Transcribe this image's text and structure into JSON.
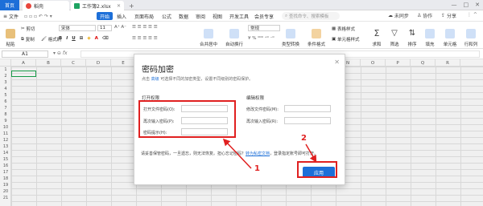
{
  "tabs": {
    "home": "首页",
    "doc": "稻壳",
    "file": "工作簿2.xlsx",
    "plus": "+"
  },
  "menu": {
    "file": "文件",
    "start": "开始",
    "insert": "插入",
    "page_layout": "页面布局",
    "formula": "公式",
    "data": "数据",
    "review": "审阅",
    "view": "视图",
    "dev": "开发工具",
    "member": "会员专享",
    "search_placeholder": "查找命令、搜索模板",
    "unsynced": "未同步",
    "collab": "协作",
    "share": "分享"
  },
  "toolbar": {
    "cut": "剪切",
    "copy": "复制",
    "format_painter": "格式刷",
    "paste": "粘贴",
    "font": "宋体",
    "size": "11",
    "merge": "合并居中",
    "wrap": "自动换行",
    "number_format": "常规",
    "type_convert": "类型转换",
    "cond_format": "条件格式",
    "table_style": "表格样式",
    "cell_style": "单元格样式",
    "sum": "求和",
    "filter": "筛选",
    "sort": "排序",
    "fill": "填充",
    "cells": "单元格",
    "rowcol": "行和列"
  },
  "formula_bar": {
    "cell_ref": "A1",
    "fx": "fx"
  },
  "columns": [
    "A",
    "B",
    "C",
    "D",
    "E",
    "F",
    "G",
    "H",
    "I",
    "J",
    "K",
    "L",
    "M",
    "N",
    "O",
    "P",
    "Q",
    "R"
  ],
  "rows": [
    "1",
    "2",
    "3",
    "4",
    "5",
    "6",
    "7",
    "8",
    "9",
    "10",
    "11",
    "12",
    "13",
    "14",
    "15",
    "16",
    "17",
    "18",
    "19",
    "20",
    "21"
  ],
  "dialog": {
    "title": "密码加密",
    "desc_prefix": "点击",
    "desc_link": "高级",
    "desc_suffix": "可选择不同的加密类型，设置不同级别的密码保护。",
    "open_section": "打开权限",
    "edit_section": "编辑权限",
    "open_pwd": "打开文件密码(O):",
    "open_confirm": "再次输入密码(P):",
    "hint": "密码提示(H):",
    "edit_pwd": "修改文件密码(M):",
    "edit_confirm": "再次输入密码(R):",
    "warn_prefix": "请妥善保管密码，一旦遗忘，则无法恢复。担心忘记密码？",
    "warn_link": "转为私密文档",
    "warn_suffix": "，登录指定账号即可打开。",
    "apply": "应用"
  },
  "annotations": {
    "step1": "1",
    "step2": "2",
    "color": "#e02020"
  }
}
